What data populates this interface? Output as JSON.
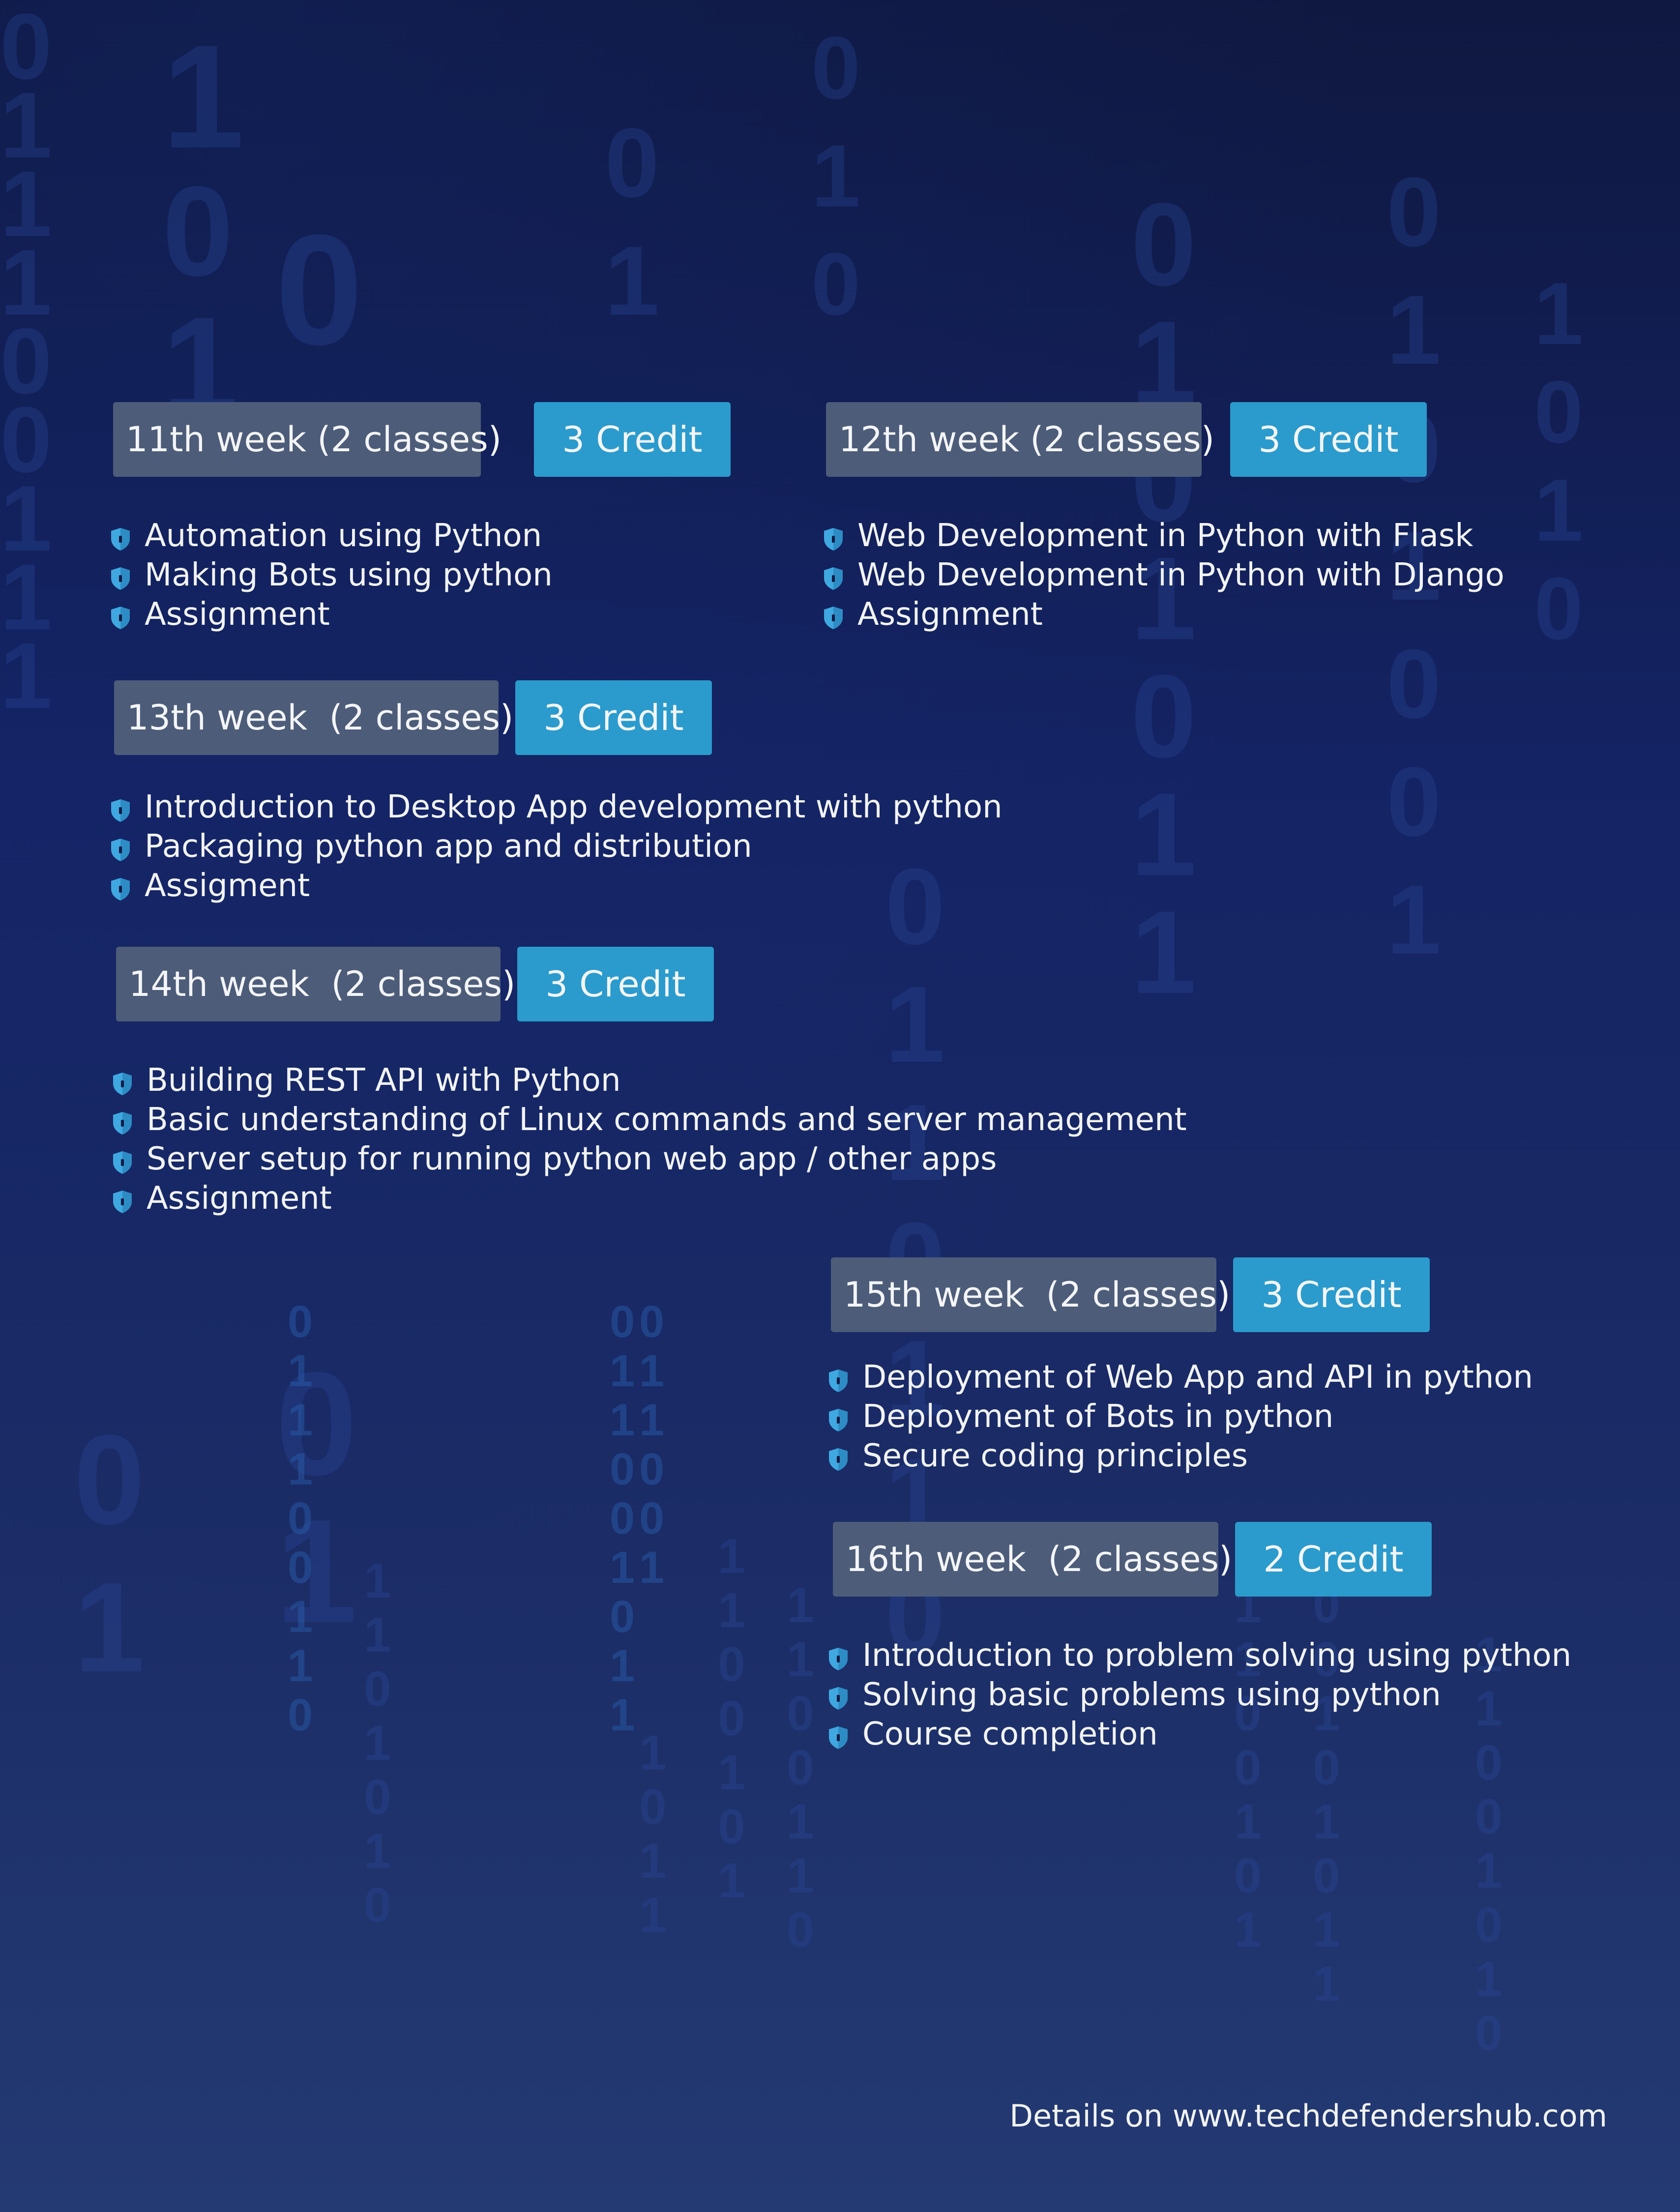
{
  "weeks": [
    {
      "label": "11th week (2 classes)",
      "credit": "3 Credit",
      "topics": [
        "Automation using Python",
        "Making Bots using python",
        "Assignment"
      ]
    },
    {
      "label": "12th week (2 classes)",
      "credit": "3 Credit",
      "topics": [
        "Web Development in Python with Flask",
        "Web Development in Python with DJango",
        "Assignment"
      ]
    },
    {
      "label": "13th week  (2 classes)",
      "credit": "3 Credit",
      "topics": [
        "Introduction to Desktop App development with python",
        "Packaging python app and distribution",
        "Assigment"
      ]
    },
    {
      "label": "14th week  (2 classes)",
      "credit": "3 Credit",
      "topics": [
        "Building REST API with Python",
        "Basic understanding of Linux commands and server management",
        "Server setup for running python web app / other apps",
        "Assignment"
      ]
    },
    {
      "label": "15th week  (2 classes)",
      "credit": "3 Credit",
      "topics": [
        "Deployment of Web App and API in python",
        "Deployment of Bots in python",
        "Secure coding principles"
      ]
    },
    {
      "label": "16th week  (2 classes)",
      "credit": "2 Credit",
      "topics": [
        "Introduction to problem solving using python",
        "Solving basic problems using python",
        "Course completion"
      ]
    }
  ],
  "footer": {
    "text": "Details on www.techdefendershub.com"
  },
  "colors": {
    "background_top": "#0f1840",
    "background_bottom": "#243a73",
    "week_label_bg": "#4d5c78",
    "credit_badge_bg": "#2a9bcc",
    "bullet_icon": "#3fa8e0",
    "binary_digits": "#2a4a9a"
  },
  "icons": {
    "bullet": "shield-icon"
  }
}
